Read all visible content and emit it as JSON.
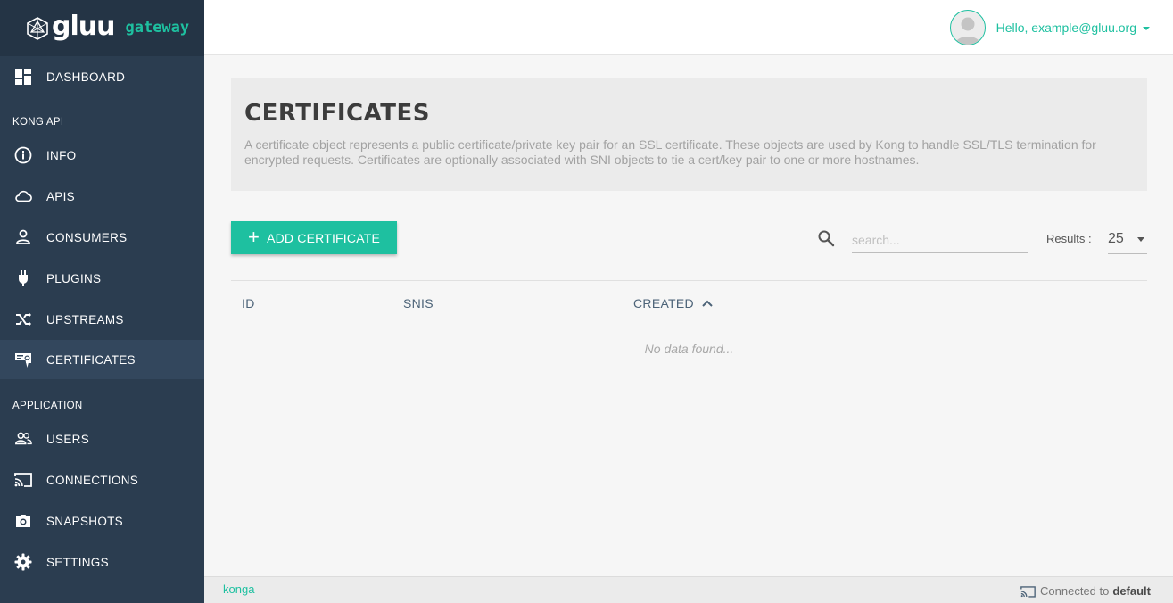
{
  "brand": {
    "word": "gluu",
    "sub": "gateway"
  },
  "sidebar": {
    "dashboard": "DASHBOARD",
    "section_kong": "KONG API",
    "section_app": "APPLICATION",
    "items": [
      {
        "label": "INFO",
        "icon": "info-icon"
      },
      {
        "label": "APIS",
        "icon": "cloud-icon"
      },
      {
        "label": "CONSUMERS",
        "icon": "person-icon"
      },
      {
        "label": "PLUGINS",
        "icon": "plug-icon"
      },
      {
        "label": "UPSTREAMS",
        "icon": "shuffle-icon"
      },
      {
        "label": "CERTIFICATES",
        "icon": "certificate-icon",
        "active": true
      },
      {
        "label": "USERS",
        "icon": "users-icon"
      },
      {
        "label": "CONNECTIONS",
        "icon": "cast-icon"
      },
      {
        "label": "SNAPSHOTS",
        "icon": "camera-icon"
      },
      {
        "label": "SETTINGS",
        "icon": "gear-icon"
      }
    ]
  },
  "topbar": {
    "greeting": "Hello, example@gluu.org"
  },
  "page": {
    "title": "CERTIFICATES",
    "description": "A certificate object represents a public certificate/private key pair for an SSL certificate. These objects are used by Kong to handle SSL/TLS termination for encrypted requests. Certificates are optionally associated with SNI objects to tie a cert/key pair to one or more hostnames."
  },
  "toolbar": {
    "add_label": "ADD CERTIFICATE",
    "search_placeholder": "search...",
    "results_label": "Results :",
    "results_value": "25"
  },
  "table": {
    "columns": [
      "ID",
      "SNIS",
      "CREATED"
    ],
    "sorted_column": "CREATED",
    "empty_text": "No data found..."
  },
  "footer": {
    "link": "konga",
    "status_prefix": "Connected to",
    "status_value": "default"
  },
  "colors": {
    "accent": "#1ec0a0",
    "sidebar": "#2b3d50",
    "sidebar_active": "#33475d"
  }
}
